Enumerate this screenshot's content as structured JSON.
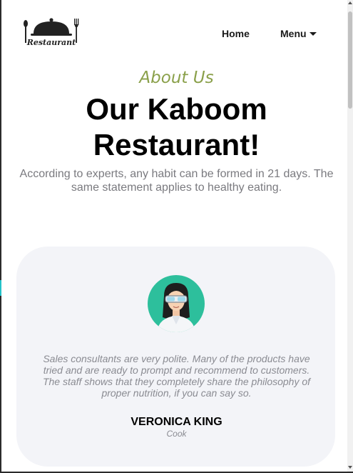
{
  "header": {
    "logo_text": "Restaurant",
    "nav": {
      "home_label": "Home",
      "menu_label": "Menu"
    }
  },
  "hero": {
    "eyebrow": "About Us",
    "title_line1": "Our Kaboom",
    "title_line2": "Restaurant!",
    "subtitle": "According to experts, any habit can be formed in 21 days. The same statement applies to healthy eating."
  },
  "testimonial": {
    "quote": "Sales consultants are very polite. Many of the products have tried and are ready to prompt and recommend to customers. The staff shows that they completely share the philosophy of proper nutrition, if you can say so.",
    "name": "VERONICA KING",
    "role": "Cook",
    "avatar_icon": "person-with-goggles-avatar"
  },
  "colors": {
    "accent_green": "#8aa04a",
    "card_bg": "#f3f4f8",
    "avatar_bg": "#2dbf9c"
  }
}
